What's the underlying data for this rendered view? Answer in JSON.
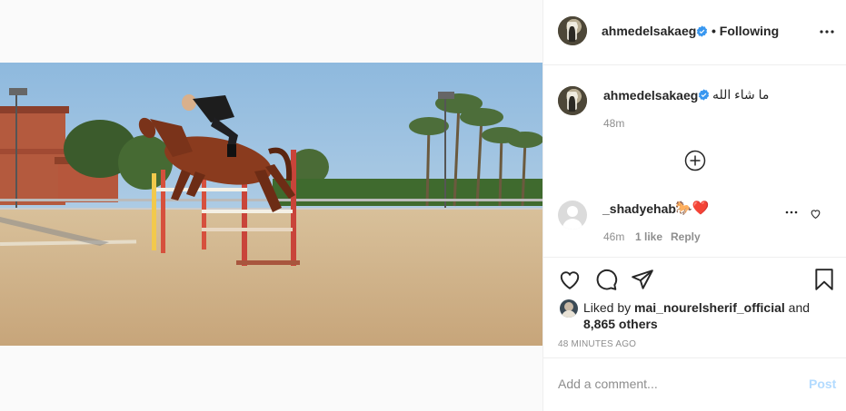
{
  "post": {
    "author": "ahmedelsakaeg",
    "follow_separator": "•",
    "follow_status": "Following",
    "caption": "ما شاء الله",
    "caption_age": "48m"
  },
  "comments": [
    {
      "user": "_shadyehab",
      "text": "🐎❤️",
      "age": "46m",
      "likes": "1 like",
      "reply_label": "Reply"
    }
  ],
  "likes": {
    "prefix": "Liked by",
    "first_liker": "mai_nourelsherif_official",
    "conjunction": "and",
    "others": "8,865 others"
  },
  "posted_ago": "48 MINUTES AGO",
  "comment_box": {
    "placeholder": "Add a comment...",
    "post_label": "Post"
  },
  "icons": {
    "verified": "verified-badge-icon",
    "more": "more-options-icon",
    "load_more": "load-more-comments-icon",
    "like": "heart-icon",
    "comment": "comment-icon",
    "share": "share-icon",
    "save": "bookmark-icon"
  },
  "colors": {
    "verified": "#3897f0",
    "heart_red": "#ed4956",
    "post_disabled": "#b3dbff",
    "secondary_text": "#8e8e8e"
  }
}
